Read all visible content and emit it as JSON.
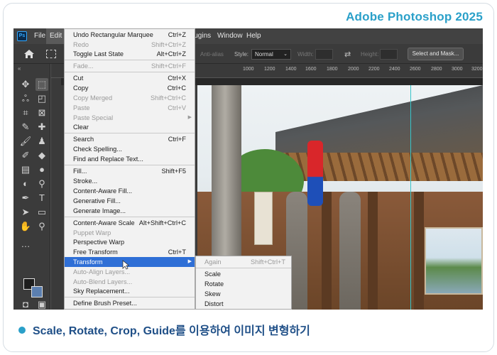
{
  "brand": "Adobe Photoshop 2025",
  "caption": "Scale, Rotate, Crop, Guide를 이용하여 이미지 변형하기",
  "menubar": {
    "logo": "Ps",
    "items": [
      "File",
      "Edit",
      "lugins",
      "Window",
      "Help"
    ]
  },
  "options": {
    "antialias": "Anti-alias",
    "style_label": "Style:",
    "style_value": "Normal",
    "width_label": "Width:",
    "height_label": "Height:",
    "select_mask": "Select and Mask..."
  },
  "ruler_ticks": [
    "1000",
    "1200",
    "1400",
    "1600",
    "1800",
    "2000",
    "2200",
    "2400",
    "2600",
    "2800",
    "3000",
    "3200"
  ],
  "edit_menu": {
    "items": [
      {
        "label": "Undo Rectangular Marquee",
        "shortcut": "Ctrl+Z",
        "disabled": false
      },
      {
        "label": "Redo",
        "shortcut": "Shift+Ctrl+Z",
        "disabled": true
      },
      {
        "label": "Toggle Last State",
        "shortcut": "Alt+Ctrl+Z",
        "disabled": false
      },
      {
        "label": "Fade...",
        "shortcut": "Shift+Ctrl+F",
        "disabled": true
      },
      {
        "label": "Cut",
        "shortcut": "Ctrl+X",
        "disabled": false
      },
      {
        "label": "Copy",
        "shortcut": "Ctrl+C",
        "disabled": false
      },
      {
        "label": "Copy Merged",
        "shortcut": "Shift+Ctrl+C",
        "disabled": true
      },
      {
        "label": "Paste",
        "shortcut": "Ctrl+V",
        "disabled": true
      },
      {
        "label": "Paste Special",
        "shortcut": "",
        "disabled": true
      },
      {
        "label": "Clear",
        "shortcut": "",
        "disabled": false
      },
      {
        "label": "Search",
        "shortcut": "Ctrl+F",
        "disabled": false
      },
      {
        "label": "Check Spelling...",
        "shortcut": "",
        "disabled": false
      },
      {
        "label": "Find and Replace Text...",
        "shortcut": "",
        "disabled": false
      },
      {
        "label": "Fill...",
        "shortcut": "Shift+F5",
        "disabled": false
      },
      {
        "label": "Stroke...",
        "shortcut": "",
        "disabled": false
      },
      {
        "label": "Content-Aware Fill...",
        "shortcut": "",
        "disabled": false
      },
      {
        "label": "Generative Fill...",
        "shortcut": "",
        "disabled": false
      },
      {
        "label": "Generate Image...",
        "shortcut": "",
        "disabled": false
      },
      {
        "label": "Content-Aware Scale",
        "shortcut": "Alt+Shift+Ctrl+C",
        "disabled": false
      },
      {
        "label": "Puppet Warp",
        "shortcut": "",
        "disabled": true
      },
      {
        "label": "Perspective Warp",
        "shortcut": "",
        "disabled": false
      },
      {
        "label": "Free Transform",
        "shortcut": "Ctrl+T",
        "disabled": false
      },
      {
        "label": "Transform",
        "shortcut": "",
        "disabled": false
      },
      {
        "label": "Auto-Align Layers...",
        "shortcut": "",
        "disabled": true
      },
      {
        "label": "Auto-Blend Layers...",
        "shortcut": "",
        "disabled": true
      },
      {
        "label": "Sky Replacement...",
        "shortcut": "",
        "disabled": false
      },
      {
        "label": "Define Brush Preset...",
        "shortcut": "",
        "disabled": false
      }
    ]
  },
  "transform_submenu": {
    "items": [
      {
        "label": "Again",
        "shortcut": "Shift+Ctrl+T",
        "disabled": true
      },
      {
        "label": "Scale",
        "shortcut": "",
        "disabled": false
      },
      {
        "label": "Rotate",
        "shortcut": "",
        "disabled": false
      },
      {
        "label": "Skew",
        "shortcut": "",
        "disabled": false
      },
      {
        "label": "Distort",
        "shortcut": "",
        "disabled": false
      }
    ]
  },
  "colors": {
    "accent": "#2aa0c9",
    "highlight": "#2f6fd6",
    "caption": "#1f4f87"
  }
}
